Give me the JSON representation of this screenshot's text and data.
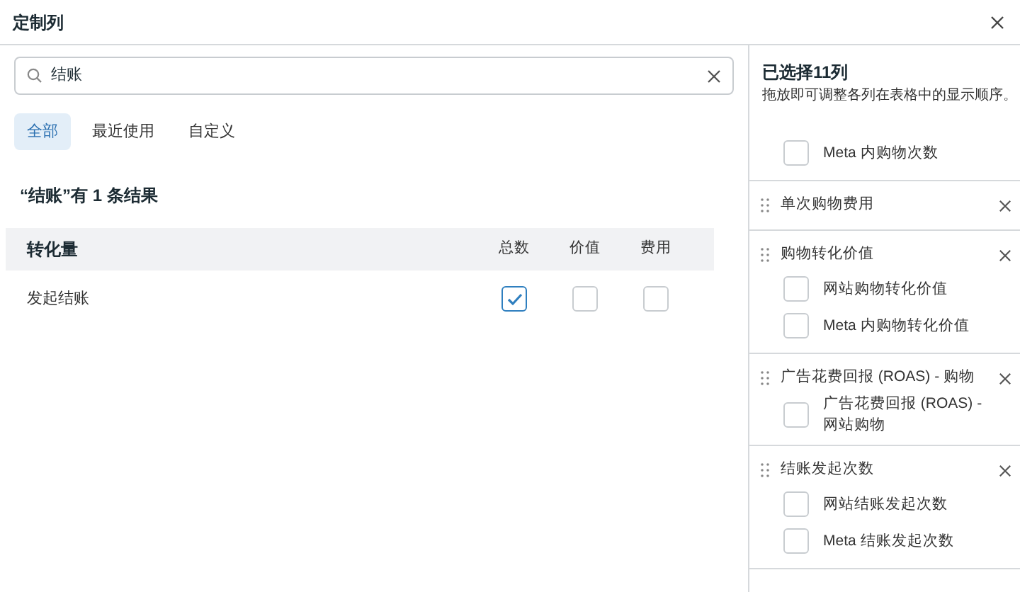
{
  "window": {
    "title": "定制列"
  },
  "search": {
    "value": "结账"
  },
  "tabs": [
    {
      "label": "全部",
      "selected": true
    },
    {
      "label": "最近使用",
      "selected": false
    },
    {
      "label": "自定义",
      "selected": false
    }
  ],
  "result_text": "“结账”有 1 条结果",
  "table": {
    "group": "转化量",
    "columns": [
      "总数",
      "价值",
      "费用"
    ],
    "rows": [
      {
        "name": "发起结账",
        "checks": [
          true,
          false,
          false
        ]
      }
    ]
  },
  "selected_panel": {
    "title": "已选择11列",
    "subtitle": "拖放即可调整各列在表格中的显示顺序。",
    "groups": [
      {
        "children": [
          {
            "label": "Meta 内购物次数",
            "checked": false
          }
        ]
      },
      {
        "label": "单次购物费用"
      },
      {
        "label": "购物转化价值",
        "children": [
          {
            "label": "网站购物转化价值",
            "checked": false
          },
          {
            "label": "Meta 内购物转化价值",
            "checked": false
          }
        ]
      },
      {
        "label": "广告花费回报 (ROAS) - 购物",
        "children": [
          {
            "label": "广告花费回报 (ROAS) - 网站购物",
            "checked": false
          }
        ]
      },
      {
        "label": "结账发起次数",
        "children": [
          {
            "label": "网站结账发起次数",
            "checked": false
          },
          {
            "label": "Meta 结账发起次数",
            "checked": false
          }
        ]
      }
    ]
  }
}
